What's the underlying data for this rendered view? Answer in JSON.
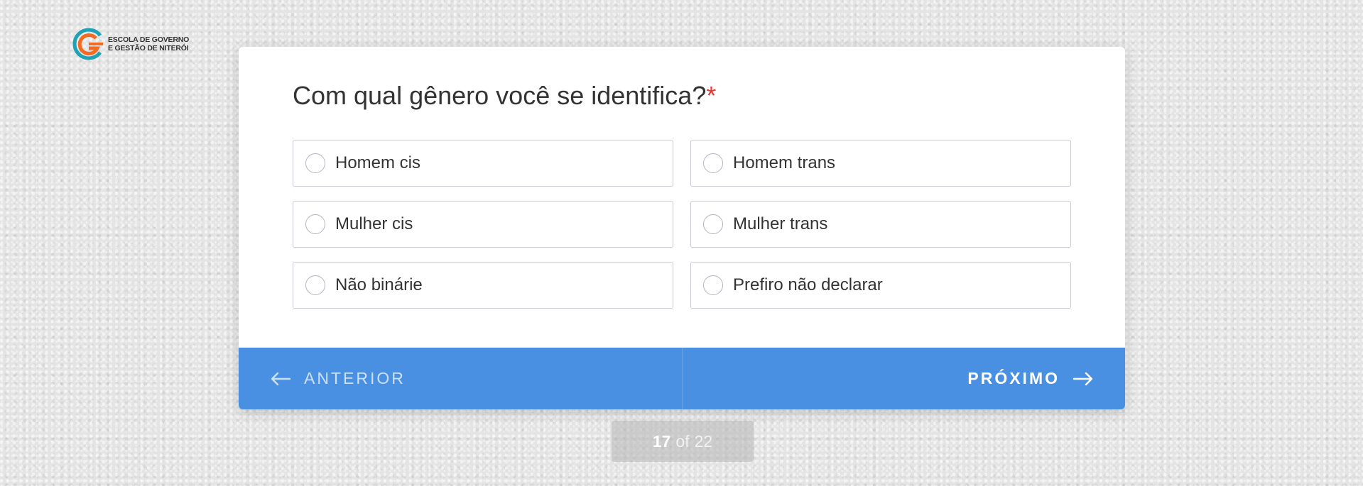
{
  "logo": {
    "line1": "ESCOLA DE GOVERNO",
    "line2": "E GESTÃO DE NITERÓI",
    "colors": [
      "#1fa2b5",
      "#f26b21"
    ]
  },
  "question": {
    "text": "Com qual gênero você se identifica?",
    "required_mark": "*"
  },
  "options": [
    {
      "label": "Homem cis",
      "selected": false
    },
    {
      "label": "Homem trans",
      "selected": false
    },
    {
      "label": "Mulher cis",
      "selected": false
    },
    {
      "label": "Mulher trans",
      "selected": false
    },
    {
      "label": "Não binárie",
      "selected": false
    },
    {
      "label": "Prefiro não declarar",
      "selected": false
    }
  ],
  "nav": {
    "prev_label": "ANTERIOR",
    "next_label": "PRÓXIMO",
    "prev_icon": "arrow-left-icon",
    "next_icon": "arrow-right-icon"
  },
  "pager": {
    "current": "17",
    "of": "of",
    "total": "22"
  },
  "colors": {
    "accent": "#4a90e2",
    "required": "#e53935",
    "text": "#333333"
  }
}
